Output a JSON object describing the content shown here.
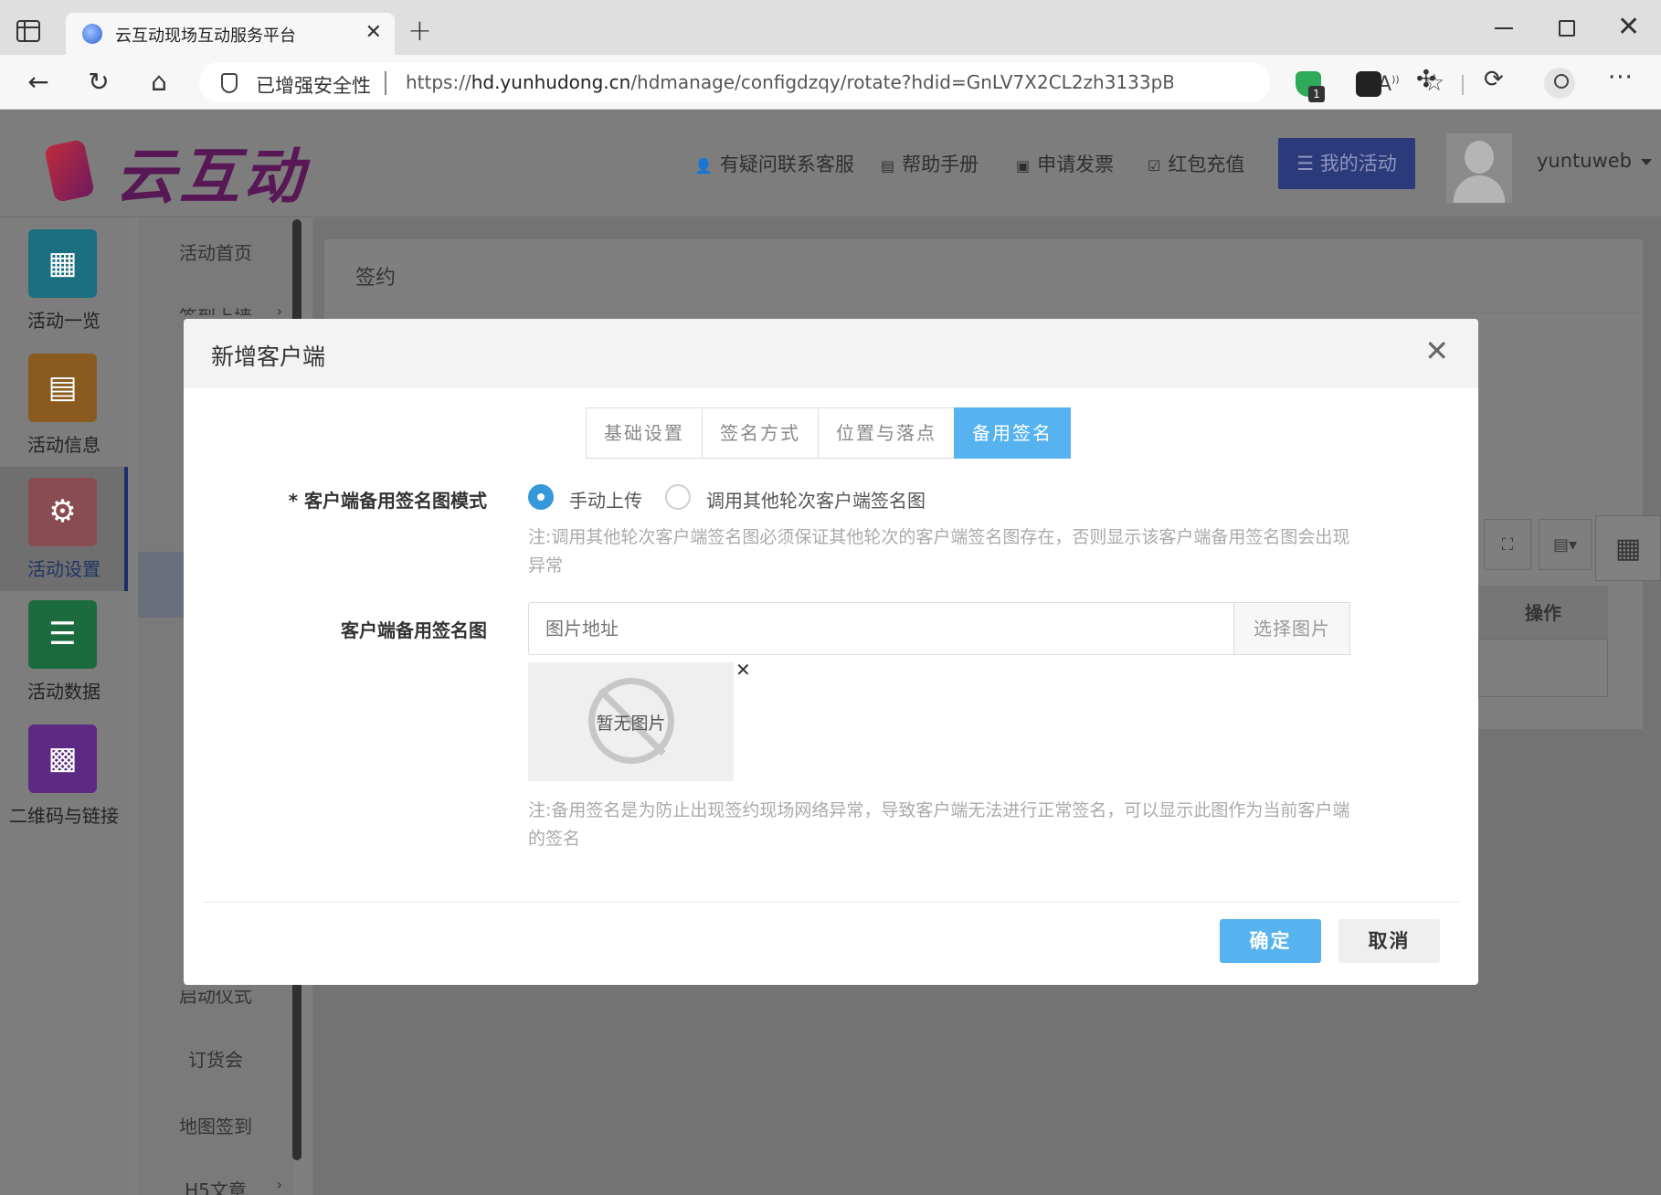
{
  "browser": {
    "tab_title": "云互动现场互动服务平台",
    "security_label": "已增强安全性",
    "url_prefix": "https://",
    "url_host": "hd.yunhudong.cn",
    "url_path": "/hdmanage/configdzqy/rotate?hdid=GnLV7X2CL2zh3133pBp1...",
    "extension_badge": "1"
  },
  "header": {
    "logo_text": "云互动",
    "links": {
      "support": "有疑问联系客服",
      "manual": "帮助手册",
      "invoice": "申请发票",
      "recharge": "红包充值"
    },
    "my_activity": "我的活动",
    "username": "yuntuweb"
  },
  "rail": {
    "items": [
      {
        "label": "活动一览",
        "icon": "grid-icon",
        "color": "#1a6f80"
      },
      {
        "label": "活动信息",
        "icon": "document-icon",
        "color": "#8a5a1e"
      },
      {
        "label": "活动设置",
        "icon": "gear-icon",
        "color": "#8a4c53",
        "active": true
      },
      {
        "label": "活动数据",
        "icon": "database-icon",
        "color": "#1b6b3e"
      },
      {
        "label": "二维码与链接",
        "icon": "qrcode-icon",
        "color": "#5c2a82"
      }
    ]
  },
  "subnav": {
    "items": [
      "活动首页",
      "签到上墙",
      "启动仪式",
      "订货会",
      "地图签到",
      "H5文章"
    ]
  },
  "main": {
    "card_title": "签约",
    "ops_header": "操作"
  },
  "modal": {
    "title": "新增客户端",
    "tabs": [
      "基础设置",
      "签名方式",
      "位置与落点",
      "备用签名"
    ],
    "active_tab": "备用签名",
    "mode_label": "* 客户端备用签名图模式",
    "mode_options": [
      "手动上传",
      "调用其他轮次客户端签名图"
    ],
    "mode_selected": "手动上传",
    "mode_note": "注:调用其他轮次客户端签名图必须保证其他轮次的客户端签名图存在，否则显示该客户端备用签名图会出现异常",
    "image_label": "客户端备用签名图",
    "image_placeholder": "图片地址",
    "pick_image": "选择图片",
    "no_image": "暂无图片",
    "image_note": "注:备用签名是为防止出现签约现场网络异常，导致客户端无法进行正常签名，可以显示此图作为当前客户端的签名",
    "confirm": "确定",
    "cancel": "取消",
    "accent_color": "#56b3ef"
  }
}
